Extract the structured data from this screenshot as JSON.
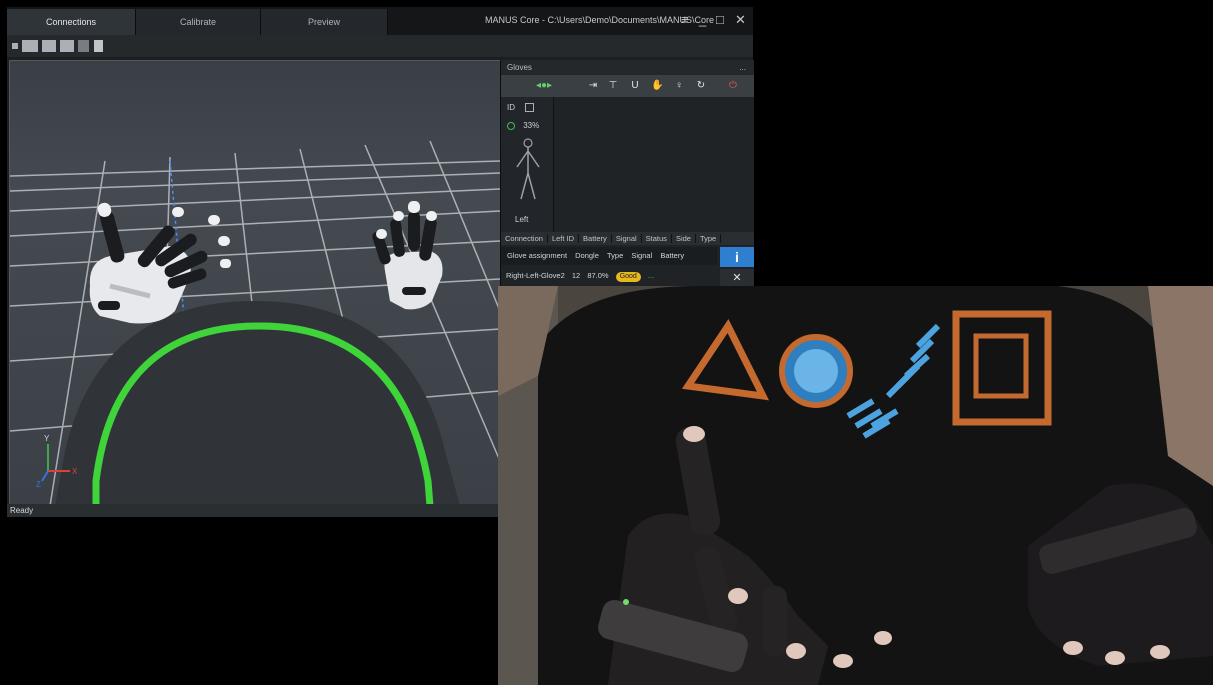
{
  "window": {
    "tabs": [
      "Connections",
      "Calibrate",
      "Preview"
    ],
    "title_path": "MANUS Core - C:\\Users\\Demo\\Documents\\MANUS\\Core",
    "menu_icon": "hamburger-icon",
    "minimize_label": "_",
    "maximize_label": "□",
    "close_label": "✕"
  },
  "toolbar": {
    "icons": [
      "view-single-icon",
      "view-grid-icon",
      "view-split-icon",
      "view-quad-icon",
      "camera-icon",
      "text-icon"
    ]
  },
  "viewport": {
    "axes": {
      "y": "Y",
      "z": "Z",
      "x": "X"
    },
    "ring_color": "#3ed43a"
  },
  "status": {
    "text": "Ready"
  },
  "panel": {
    "title": "Gloves",
    "more": "...",
    "pair_toggle": "✓",
    "show_label": "ID",
    "signal": "33%",
    "figure_label": "Left",
    "table_headers": [
      "Connection",
      "Left ID",
      "Battery",
      "Signal",
      "Status",
      "Side",
      "Type"
    ],
    "gloves_label": "Glove assignment",
    "gloves_cols": [
      "Dongle",
      "Type",
      "Signal",
      "Battery"
    ],
    "glove_name": "Right-Left-Glove2",
    "glove_id": "12",
    "glove_battery": "87.0%",
    "glove_status": "Good",
    "glove_extra": "...",
    "info_label": "i",
    "close_label": "✕",
    "tool_icons": [
      "user-icon",
      "wrench-icon",
      "hand-icon",
      "magnet-icon",
      "glove-icon",
      "bulb-icon",
      "refresh-icon",
      "power-icon"
    ]
  },
  "camera": {
    "shirt_graphic": "ACG circuit logo"
  }
}
